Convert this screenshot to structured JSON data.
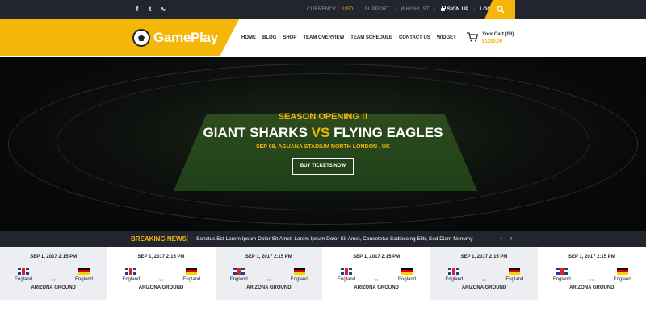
{
  "topbar": {
    "social": [
      {
        "icon": "facebook-icon",
        "glyph": "f"
      },
      {
        "icon": "twitter-icon",
        "glyph": "t"
      },
      {
        "icon": "rss-icon",
        "glyph": "∿"
      }
    ],
    "currency_label": "CURRENCY :",
    "currency_value": "USD",
    "support": "SUPPORT",
    "wishlist": "WHISHLIST",
    "signup": "SIGN UP",
    "login": "LOGIN"
  },
  "header": {
    "logo_text": "GamePlay",
    "nav": [
      "HOME",
      "BLOG",
      "SHOP",
      "TEAM OVERVIEW",
      "TEAM SCHEDULE",
      "CONTACT US",
      "WIDGET"
    ],
    "cart_title": "Your Cart (03)",
    "cart_amount": "$1200.00"
  },
  "hero": {
    "season": "SEASON OPENING !!",
    "team1": "GIANT SHARKS",
    "vs": "VS",
    "team2": "FLYING EAGLES",
    "venue": "SEP 09, AGUANA STADIUM NORTH LONDON , UK",
    "button": "BUY TICKETS NOW"
  },
  "news": {
    "label": "BREAKING NEWS",
    "text": "Sanctus Est Lorem Ipsum Dolor Sit Amet. Lorem Ipsum Dolor Sit Amet, Consetetur Sadipscing Elitr, Sed Diam Nonumy",
    "prev": "‹",
    "next": "›"
  },
  "fixtures": [
    {
      "date": "SEP 1, 2017 2:15 PM",
      "team1": "England",
      "vs": "vs",
      "team2": "England",
      "ground": "ARIZONA GROUND"
    },
    {
      "date": "SEP 1, 2017 2:15 PM",
      "team1": "England",
      "vs": "vs",
      "team2": "England",
      "ground": "ARIZONA GROUND"
    },
    {
      "date": "SEP 1, 2017 2:15 PM",
      "team1": "England",
      "vs": "vs",
      "team2": "England",
      "ground": "ARIZONA GROUND"
    },
    {
      "date": "SEP 1, 2017 2:15 PM",
      "team1": "England",
      "vs": "vs",
      "team2": "England",
      "ground": "ARIZONA GROUND"
    },
    {
      "date": "SEP 1, 2017 2:15 PM",
      "team1": "England",
      "vs": "vs",
      "team2": "England",
      "ground": "ARIZONA GROUND"
    },
    {
      "date": "SEP 1, 2017 2:15 PM",
      "team1": "England",
      "vs": "vs",
      "team2": "England",
      "ground": "ARIZONA GROUND"
    }
  ],
  "colors": {
    "accent": "#f5b60a",
    "dark": "#22252d"
  }
}
